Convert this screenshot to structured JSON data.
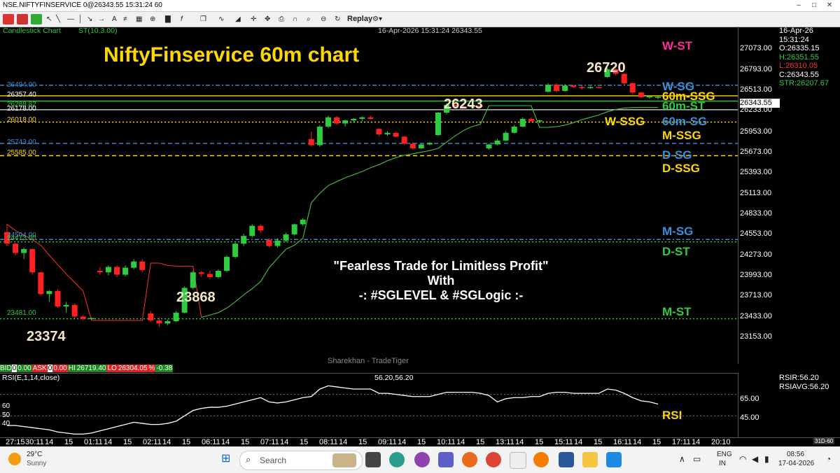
{
  "window": {
    "title": "NSE.NIFTYFINSERVICE 0@26343.55 15:31:24 60"
  },
  "toolbar": {
    "replay_label": "Replay"
  },
  "chart_header": {
    "type_label": "Candlestick Chart",
    "indicator_label": "ST(10,3.00)",
    "datetime_price": "16-Apr-2026 15:31:24 26343.55"
  },
  "chart_title": "NiftyFinservice 60m chart",
  "callouts": {
    "high": "26720",
    "p26243": "26243",
    "p23868": "23868",
    "p23374": "23374"
  },
  "banner": {
    "line1": "\"Fearless Trade for Limitless Profit\"",
    "line2": "With",
    "line3": "-: #SGLEVEL & #SGLogic :-"
  },
  "watermark": "Sharekhan - TradeTiger",
  "levels": [
    {
      "value": "26494.00",
      "color": "#3a8fd9"
    },
    {
      "value": "26357.40",
      "color": "#ffffff"
    },
    {
      "value": "26288.82",
      "color": "#2ecc40"
    },
    {
      "value": "26178.00",
      "color": "#ffffff"
    },
    {
      "value": "26018.00",
      "color": "#ffd700"
    },
    {
      "value": "25743.00",
      "color": "#3a8fd9"
    },
    {
      "value": "25585.00",
      "color": "#ffd700"
    },
    {
      "value": "24504.00",
      "color": "#3a8fd9"
    },
    {
      "value": "24473.00",
      "color": "#2ecc40"
    },
    {
      "value": "23481.00",
      "color": "#2ecc40"
    }
  ],
  "right_labels": {
    "w_st": "W-ST",
    "w_sg": "W-SG",
    "m60_ssg": "60m-SSG",
    "m60_st": "60m-ST",
    "w_ssg": "W-SSG",
    "m60_sg": "60m-SG",
    "m_ssg": "M-SSG",
    "d_sg": "D-SG",
    "d_ssg": "D-SSG",
    "m_sg": "M-SG",
    "d_st": "D-ST",
    "m_st": "M-ST",
    "rsi": "RSI"
  },
  "y_axis": [
    "27073.00",
    "26793.00",
    "26513.00",
    "26233.00",
    "25953.00",
    "25673.00",
    "25393.00",
    "25113.00",
    "24833.00",
    "24553.00",
    "24273.00",
    "23993.00",
    "23713.00",
    "23433.00",
    "23153.00"
  ],
  "current_price": "26343.55",
  "ohlc": {
    "date": "16-Apr-26",
    "time": "15:31:24",
    "open": "O:26335.15",
    "high": "H:26351.55",
    "low": "L:26310.05",
    "close": "C:26343.55",
    "str": "STR:26207.67"
  },
  "quote_bar": {
    "bid_label": "BID",
    "bid_qty": "0",
    "bid_price": "0.00",
    "ask_label": "ASK",
    "ask_qty": "0",
    "ask_price": "0.00",
    "hi_label": "HI",
    "hi": "26719.40",
    "lo_label": "LO",
    "lo": "26304.05",
    "pct_label": "%",
    "pct": "-0.38"
  },
  "rsi_panel": {
    "title": "RSI(E,1,14,close)",
    "values": "56.20,56.20",
    "rsir": "RSIR:56.20",
    "rsiavg": "RSIAVG:56.20",
    "axis": [
      "65.00",
      "45.00"
    ],
    "left": [
      "60",
      "50",
      "40"
    ]
  },
  "x_axis": [
    "27:15",
    "30:11",
    "14",
    "15",
    "01:11",
    "14",
    "15",
    "02:11",
    "14",
    "15",
    "06:11",
    "14",
    "15",
    "07:11",
    "14",
    "15",
    "08:11",
    "14",
    "15",
    "09:11",
    "14",
    "15",
    "10:11",
    "14",
    "15",
    "13:11",
    "14",
    "15",
    "15:11",
    "14",
    "15",
    "16:11",
    "14",
    "15",
    "17:11",
    "14",
    "20:10"
  ],
  "x_corner": "31D-60",
  "weather": {
    "temp": "29°C",
    "desc": "Sunny"
  },
  "search": {
    "placeholder": "Search"
  },
  "tray": {
    "lang1": "ENG",
    "lang2": "IN",
    "time": "08:56",
    "date": "17-04-2026"
  },
  "chart_data": {
    "type": "candlestick",
    "ylim": [
      22900,
      27250
    ],
    "candles": [
      [
        24600,
        24700,
        24420,
        24450
      ],
      [
        24450,
        24460,
        24300,
        24330
      ],
      [
        24330,
        24400,
        24250,
        24380
      ],
      [
        24380,
        24390,
        24050,
        24080
      ],
      [
        24080,
        24090,
        23780,
        23800
      ],
      [
        23800,
        23850,
        23700,
        23840
      ],
      [
        23840,
        23860,
        23620,
        23640
      ],
      [
        23640,
        23700,
        23560,
        23660
      ],
      [
        23660,
        23680,
        23490,
        23510
      ],
      [
        23510,
        23530,
        23460,
        23480
      ],
      [
        23480,
        23500,
        23470,
        23490
      ],
      [
        24100,
        24150,
        24050,
        24080
      ],
      [
        24080,
        24170,
        24040,
        24150
      ],
      [
        24150,
        24170,
        24020,
        24050
      ],
      [
        24050,
        24170,
        24030,
        24140
      ],
      [
        24140,
        24250,
        24120,
        24220
      ],
      [
        24220,
        24250,
        24080,
        24110
      ],
      [
        23550,
        23580,
        23440,
        23460
      ],
      [
        23460,
        23500,
        23380,
        23420
      ],
      [
        23420,
        23470,
        23400,
        23450
      ],
      [
        23450,
        23580,
        23440,
        23560
      ],
      [
        23560,
        23900,
        23550,
        23880
      ],
      [
        23880,
        24100,
        23860,
        24080
      ],
      [
        24080,
        24100,
        24020,
        24060
      ],
      [
        24060,
        24100,
        23990,
        24020
      ],
      [
        24020,
        24120,
        24000,
        24100
      ],
      [
        24100,
        24300,
        24080,
        24280
      ],
      [
        24280,
        24470,
        24260,
        24450
      ],
      [
        24450,
        24580,
        24420,
        24550
      ],
      [
        24550,
        24700,
        24530,
        24680
      ],
      [
        24680,
        24700,
        24590,
        24620
      ],
      [
        24500,
        24520,
        24400,
        24420
      ],
      [
        24420,
        24520,
        24400,
        24490
      ],
      [
        24490,
        24590,
        24470,
        24570
      ],
      [
        24570,
        24710,
        24550,
        24700
      ],
      [
        24700,
        24780,
        24680,
        24760
      ],
      [
        25800,
        25900,
        25700,
        25720
      ],
      [
        25720,
        25980,
        25700,
        25960
      ],
      [
        25960,
        26100,
        25940,
        26080
      ],
      [
        26080,
        26100,
        25980,
        26000
      ],
      [
        26000,
        26050,
        25960,
        26040
      ],
      [
        26040,
        26070,
        26010,
        26060
      ],
      [
        26060,
        26090,
        26030,
        26080
      ],
      [
        26080,
        26100,
        26050,
        26060
      ],
      [
        25930,
        25940,
        25840,
        25860
      ],
      [
        25860,
        25900,
        25840,
        25880
      ],
      [
        25880,
        25890,
        25820,
        25830
      ],
      [
        25830,
        25840,
        25720,
        25740
      ],
      [
        25740,
        25760,
        25660,
        25680
      ],
      [
        25680,
        25740,
        25670,
        25730
      ],
      [
        25730,
        25760,
        25720,
        25750
      ],
      [
        25850,
        26150,
        25840,
        26140
      ],
      [
        26140,
        26260,
        26120,
        26240
      ],
      [
        26240,
        26250,
        26200,
        26220
      ],
      [
        26220,
        26240,
        26200,
        26210
      ],
      [
        26210,
        26240,
        26195,
        26230
      ],
      [
        26230,
        26245,
        26200,
        26220
      ],
      [
        25680,
        25740,
        25660,
        25730
      ],
      [
        25730,
        25800,
        25720,
        25780
      ],
      [
        25780,
        25900,
        25770,
        25880
      ],
      [
        25880,
        25980,
        25870,
        25960
      ],
      [
        25960,
        26080,
        25950,
        26060
      ],
      [
        26060,
        26080,
        26020,
        26030
      ],
      [
        26030,
        26050,
        26020,
        26040
      ],
      [
        26410,
        26520,
        26400,
        26500
      ],
      [
        26500,
        26520,
        26400,
        26420
      ],
      [
        26420,
        26510,
        26410,
        26490
      ],
      [
        26490,
        26500,
        26460,
        26470
      ],
      [
        26470,
        26490,
        26440,
        26460
      ],
      [
        26460,
        26480,
        26450,
        26470
      ],
      [
        26470,
        26480,
        26455,
        26465
      ],
      [
        26600,
        26720,
        26590,
        26700
      ],
      [
        26700,
        26710,
        26620,
        26640
      ],
      [
        26640,
        26650,
        26500,
        26520
      ],
      [
        26520,
        26530,
        26380,
        26400
      ],
      [
        26400,
        26410,
        26330,
        26340
      ],
      [
        26340,
        26360,
        26320,
        26350
      ],
      [
        26335,
        26352,
        26310,
        26344
      ]
    ],
    "supertrend": [
      24700,
      24620,
      24560,
      24500,
      24430,
      24300,
      24180,
      24060,
      23950,
      23840,
      23460,
      23460,
      23460,
      23460,
      23460,
      23460,
      23460,
      24200,
      24200,
      24170,
      24160,
      24160,
      24160,
      23500,
      23530,
      23560,
      23620,
      23700,
      23790,
      23870,
      23960,
      24140,
      24260,
      24380,
      24430,
      24520,
      24980,
      25100,
      25200,
      25250,
      25300,
      25340,
      25380,
      25430,
      25470,
      25520,
      25560,
      25590,
      25610,
      25630,
      25650,
      25680,
      25760,
      25840,
      25910,
      25960,
      25990,
      26230,
      26230,
      26230,
      26230,
      26230,
      26230,
      25950,
      25950,
      25960,
      25980,
      26010,
      26050,
      26080,
      26110,
      26150,
      26180,
      26200,
      26205,
      26207,
      26207,
      26207
    ],
    "rsi": [
      36,
      36,
      35,
      34,
      33,
      32,
      30,
      29,
      28,
      28,
      29,
      31,
      33,
      35,
      37,
      39,
      38,
      37,
      37,
      38,
      40,
      45,
      50,
      52,
      53,
      53,
      54,
      56,
      58,
      60,
      62,
      58,
      57,
      58,
      60,
      62,
      63,
      70,
      73,
      72,
      71,
      70,
      70,
      70,
      66,
      66,
      65,
      64,
      63,
      63,
      63,
      65,
      67,
      67,
      67,
      67,
      66,
      64,
      58,
      61,
      62,
      62,
      63,
      63,
      66,
      67,
      67,
      66,
      66,
      66,
      66,
      70,
      69,
      66,
      62,
      59,
      58,
      56
    ]
  }
}
